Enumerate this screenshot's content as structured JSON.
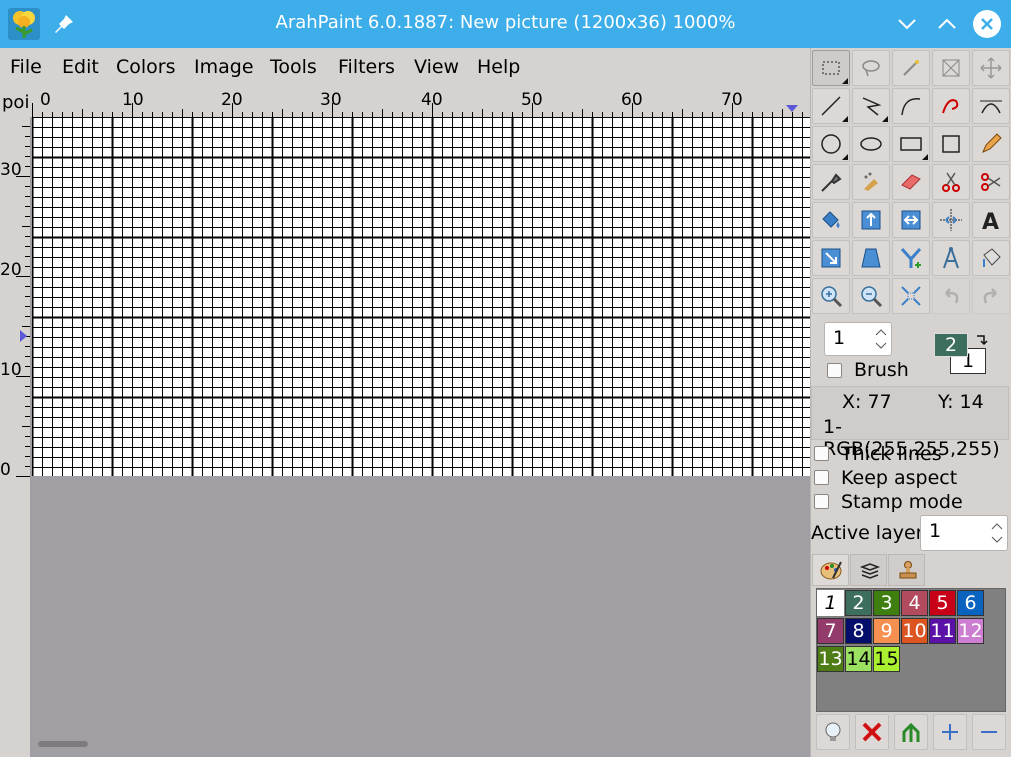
{
  "window": {
    "title": "ArahPaint 6.0.1887: New picture (1200x36) 1000%"
  },
  "menu": [
    "File",
    "Edit",
    "Colors",
    "Image",
    "Tools",
    "Filters",
    "View",
    "Help"
  ],
  "ruler": {
    "unit": "poi",
    "top_labels": [
      "0",
      "10",
      "20",
      "30",
      "40",
      "50",
      "60",
      "70"
    ],
    "left_labels": [
      "30",
      "20",
      "10",
      "0"
    ]
  },
  "brush": {
    "size": "1",
    "label": "Brush",
    "fg_color_index": "2",
    "bg_color_index": "1"
  },
  "coords": {
    "x": "X: 77",
    "y": "Y: 14",
    "color": "1-RGB(255,255,255)"
  },
  "options": {
    "thick_lines": "Thick lines",
    "keep_aspect": "Keep aspect",
    "stamp_mode": "Stamp mode"
  },
  "layer": {
    "label": "Active layer:",
    "value": "1"
  },
  "palette": [
    {
      "n": "1",
      "color": "#ffffff"
    },
    {
      "n": "2",
      "color": "#3e6e5e"
    },
    {
      "n": "3",
      "color": "#3f7f10"
    },
    {
      "n": "4",
      "color": "#b14b5d"
    },
    {
      "n": "5",
      "color": "#c80018"
    },
    {
      "n": "6",
      "color": "#0a63be"
    },
    {
      "n": "7",
      "color": "#933c6b"
    },
    {
      "n": "8",
      "color": "#050e6b"
    },
    {
      "n": "9",
      "color": "#f59050"
    },
    {
      "n": "10",
      "color": "#dc5520"
    },
    {
      "n": "11",
      "color": "#5b10a8"
    },
    {
      "n": "12",
      "color": "#cc7fd0"
    },
    {
      "n": "13",
      "color": "#4e7c16"
    },
    {
      "n": "14",
      "color": "#9be060"
    },
    {
      "n": "15",
      "color": "#aaf030"
    }
  ],
  "colors": {
    "titlebar": "#3daee9",
    "canvas_bg": "#a19fa4",
    "panel_bg": "#d6d2d0"
  }
}
